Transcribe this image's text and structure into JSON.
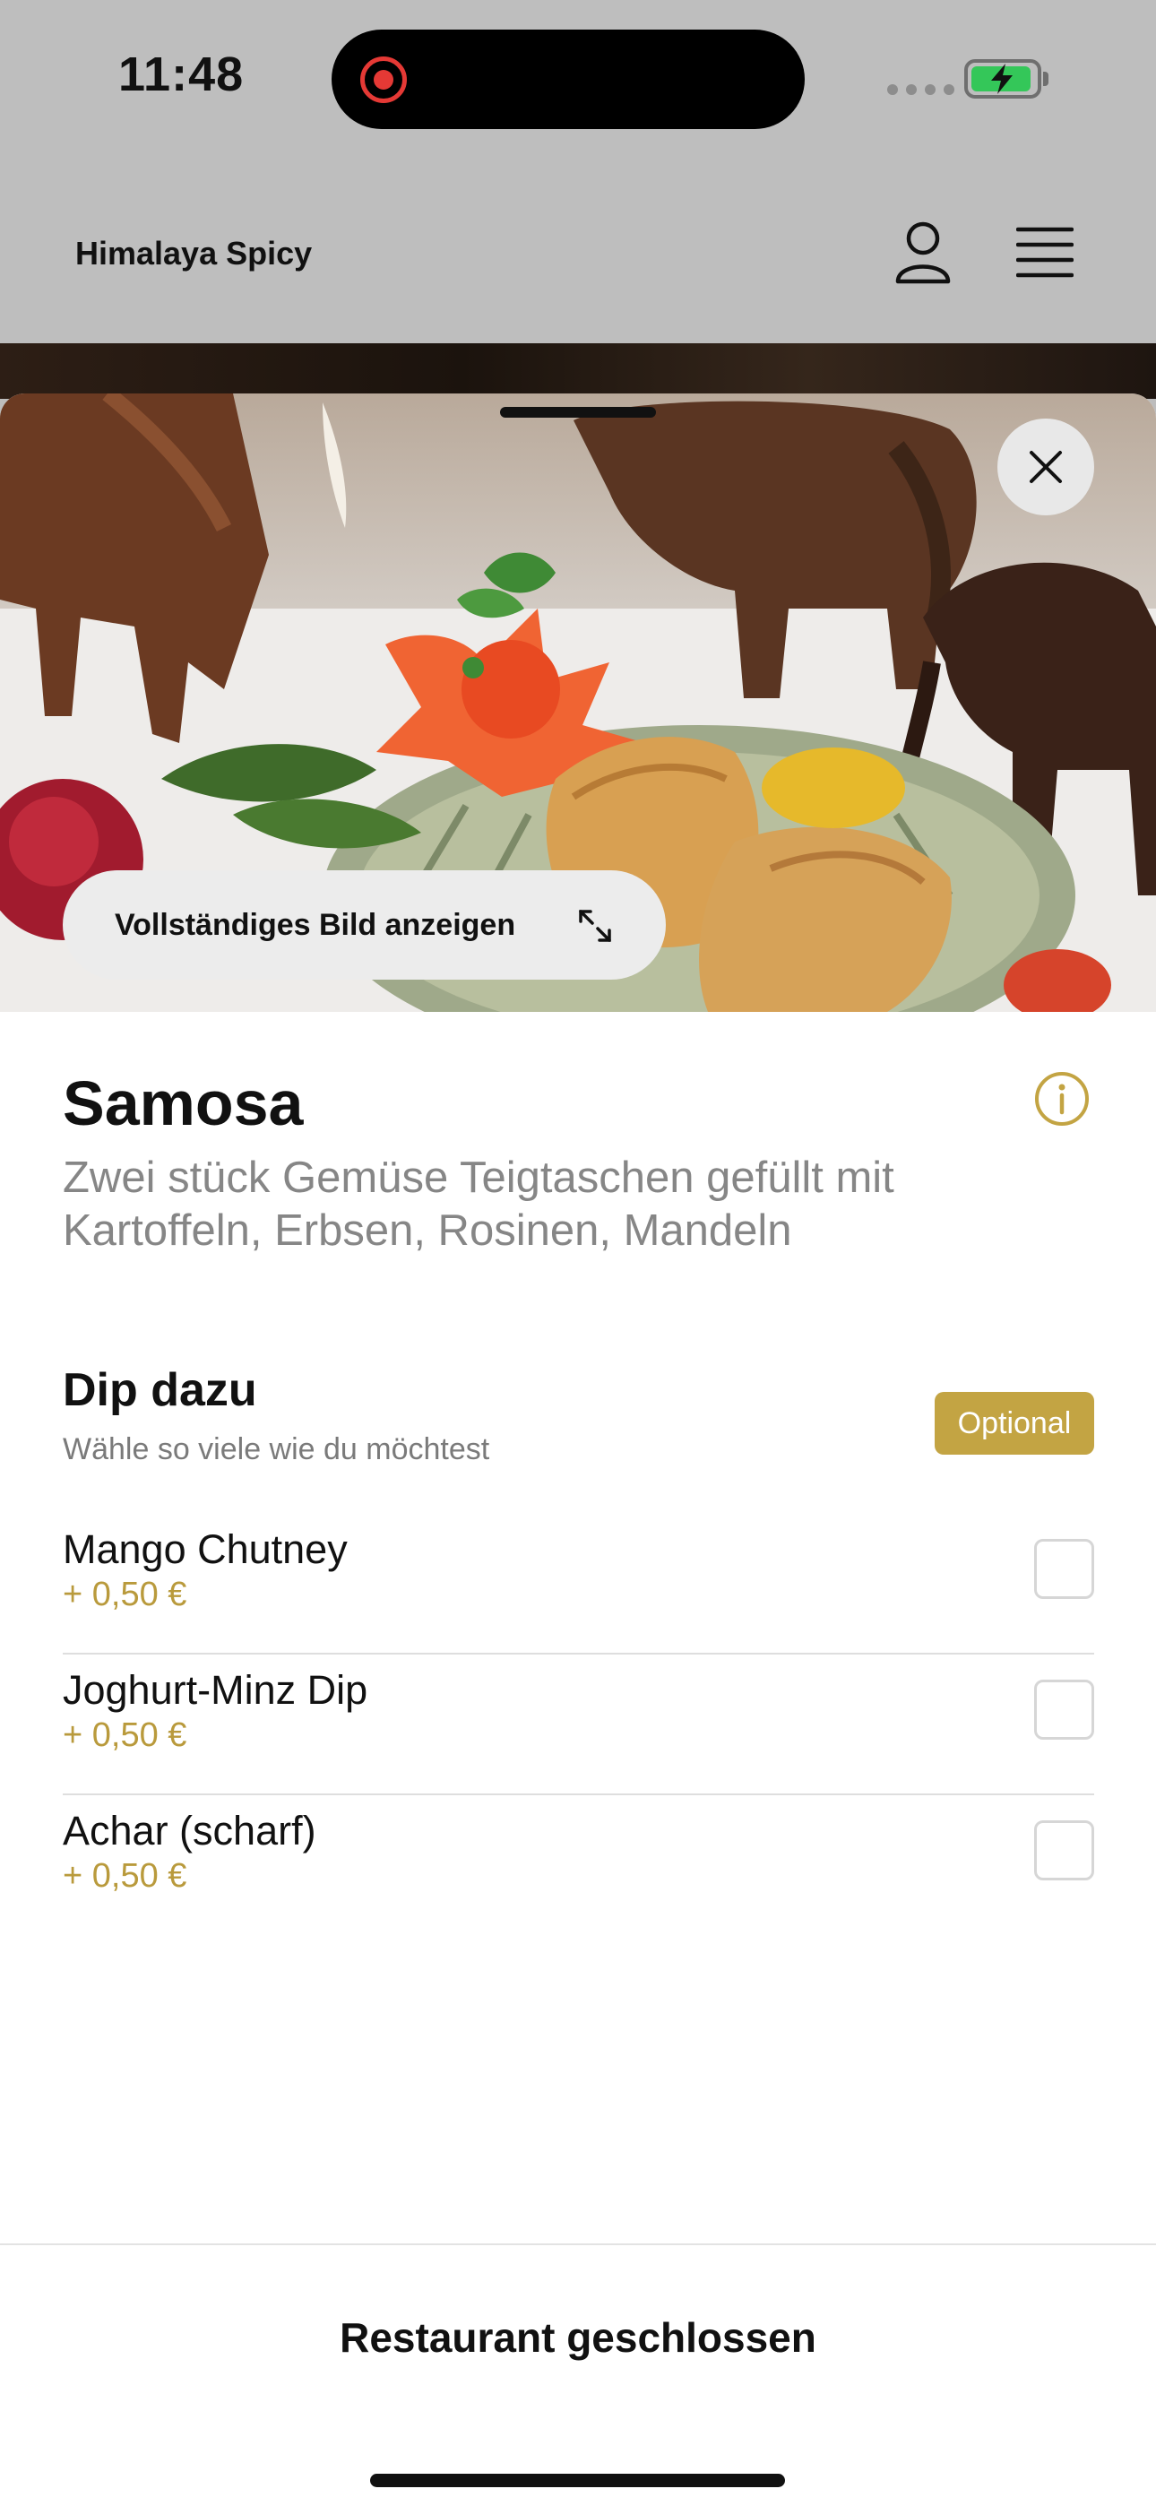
{
  "status_bar": {
    "time": "11:48"
  },
  "header": {
    "restaurant_name": "Himalaya Spicy",
    "icons": [
      "account-icon",
      "hamburger-menu-icon"
    ]
  },
  "hero": {
    "full_image_label": "Vollständiges Bild anzeigen",
    "icons": [
      "close-icon",
      "expand-icon"
    ]
  },
  "dish": {
    "title": "Samosa",
    "description": "Zwei stück Gemüse Teigtaschen gefüllt mit Kartoffeln, Erbsen, Rosinen, Mandeln"
  },
  "option_group": {
    "title": "Dip dazu",
    "subtitle": "Wähle so viele wie du möchtest",
    "badge": "Optional",
    "options": [
      {
        "name": "Mango Chutney",
        "price": "+ 0,50 €",
        "checked": false
      },
      {
        "name": "Joghurt-Minz Dip",
        "price": "+ 0,50 €",
        "checked": false
      },
      {
        "name": "Achar (scharf)",
        "price": "+ 0,50 €",
        "checked": false
      }
    ]
  },
  "footer": {
    "status": "Restaurant geschlossen"
  },
  "colors": {
    "accent": "#c3a443",
    "price": "#b99a3c",
    "header_bg": "#bebebe",
    "battery_green": "#34c759",
    "record_red": "#e53935"
  }
}
